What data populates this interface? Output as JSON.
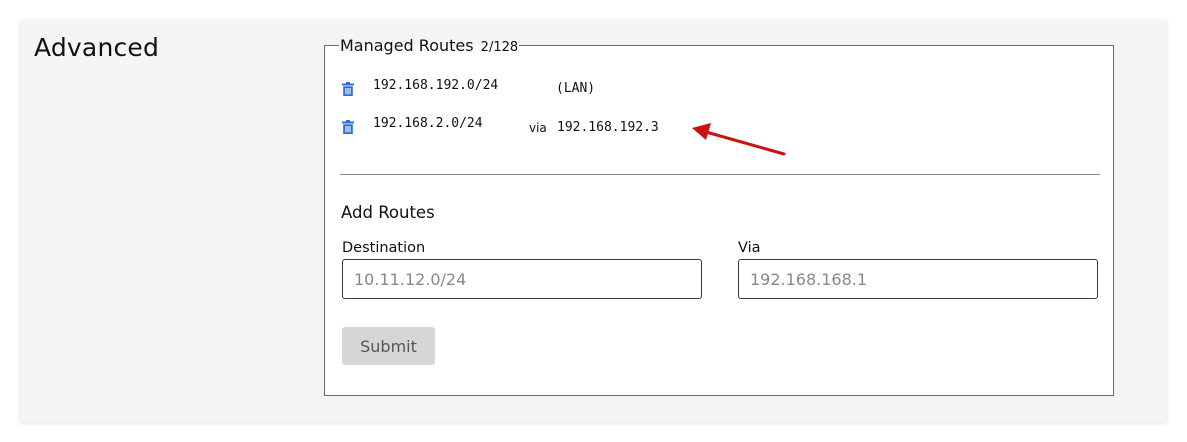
{
  "section": {
    "title": "Advanced"
  },
  "managed_routes": {
    "legend": "Managed Routes",
    "count": "2/128",
    "routes": [
      {
        "cidr": "192.168.192.0/24",
        "tag": "(LAN)",
        "via_label": "",
        "via_ip": "",
        "delete_icon": "trash-icon"
      },
      {
        "cidr": "192.168.2.0/24",
        "tag": "",
        "via_label": "via",
        "via_ip": "192.168.192.3",
        "delete_icon": "trash-icon"
      }
    ]
  },
  "add_routes": {
    "title": "Add Routes",
    "destination_label": "Destination",
    "destination_placeholder": "10.11.12.0/24",
    "destination_value": "",
    "via_label": "Via",
    "via_placeholder": "192.168.168.1",
    "via_value": "",
    "submit_label": "Submit"
  },
  "colors": {
    "trash_icon": "#2f6fd1",
    "annotation_arrow": "#cc1111",
    "submit_bg": "#d6d6d6"
  },
  "annotation": {
    "icon": "red-arrow-icon"
  }
}
